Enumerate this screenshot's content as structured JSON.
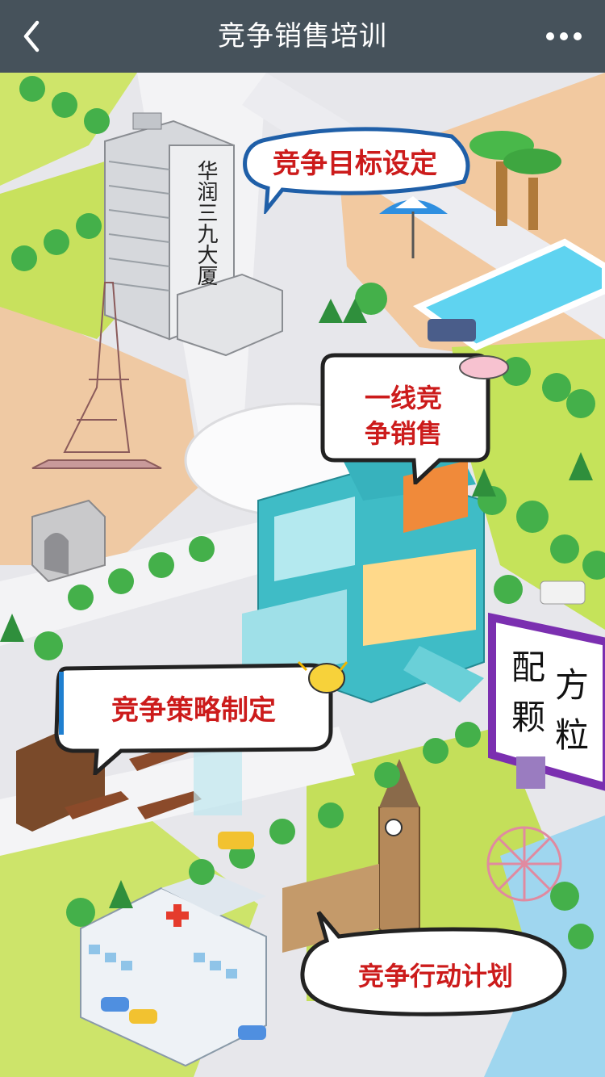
{
  "header": {
    "title": "竞争销售培训",
    "back_icon": "chevron-left-icon",
    "more_icon": "more-horizontal-icon"
  },
  "map": {
    "building_sign": "华润三九大厦",
    "bubbles": {
      "goal_setting": "竞争目标设定",
      "frontline_line1": "一线竞",
      "frontline_line2": "争销售",
      "strategy": "竞争策略制定",
      "action_plan": "竞争行动计划"
    },
    "billboard": {
      "col1_top": "配",
      "col1_bottom": "颗",
      "col2_top": "方",
      "col2_bottom": "粒"
    }
  },
  "colors": {
    "header_bg": "#46525b",
    "bubble_text": "#cc1b1b",
    "billboard_frame": "#7b2fb0",
    "pool_water": "#5fd3f0",
    "beach": "#f2c9a0",
    "grass": "#b7e14d",
    "road": "#e4e4e8",
    "water": "#9fd6ef"
  }
}
